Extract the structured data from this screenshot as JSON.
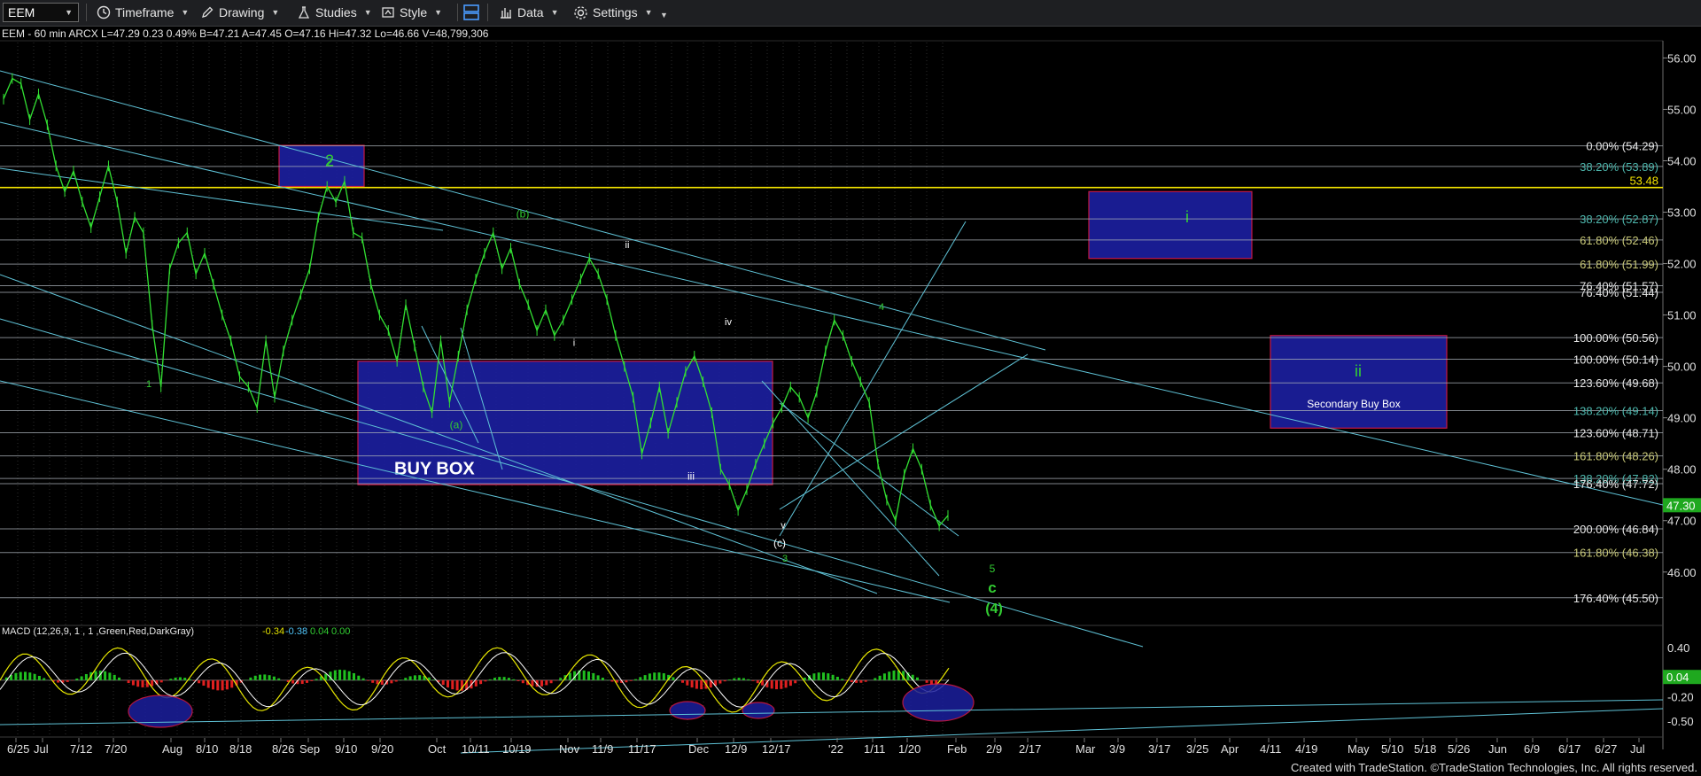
{
  "toolbar": {
    "symbol": "EEM",
    "timeframe": "Timeframe",
    "drawing": "Drawing",
    "studies": "Studies",
    "style": "Style",
    "data": "Data",
    "settings": "Settings"
  },
  "header": {
    "info": "EEM - 60 min  ARCX  L=47.29  0.23  0.49%  B=47.21  A=47.45  O=47.16  Hi=47.32  Lo=46.66  V=48,799,306"
  },
  "macd": {
    "label": "MACD (12,26,9, 1 , 1 ,Green,Red,DarkGray)",
    "v1": "-0.34",
    "v2": "-0.38",
    "v3": "0.04",
    "v4": "0.00"
  },
  "chart_data": {
    "type": "line",
    "price_axis": {
      "ticks": [
        "56.00",
        "55.00",
        "54.00",
        "53.00",
        "52.00",
        "51.00",
        "50.00",
        "49.00",
        "48.00",
        "47.00",
        "46.00"
      ],
      "range": [
        45.1,
        56.3
      ]
    },
    "macd_axis": {
      "ticks": [
        "0.40",
        "-0.20",
        "-0.50"
      ],
      "range": [
        -0.62,
        0.52
      ]
    },
    "x_labels": [
      "6/25",
      "Jul",
      "7/12",
      "7/20",
      "Aug",
      "8/10",
      "8/18",
      "8/26",
      "Sep",
      "9/10",
      "9/20",
      "Oct",
      "10/11",
      "10/19",
      "Nov",
      "11/9",
      "11/17",
      "Dec",
      "12/9",
      "12/17",
      "'22",
      "1/11",
      "1/20",
      "Feb",
      "2/9",
      "2/17",
      "Mar",
      "3/9",
      "3/17",
      "3/25",
      "Apr",
      "4/11",
      "4/19",
      "May",
      "5/10",
      "5/18",
      "5/26",
      "Jun",
      "6/9",
      "6/17",
      "6/27",
      "Jul"
    ],
    "last_price": "47.30",
    "last_macd": "0.04",
    "series": [
      {
        "values": [
          55.2,
          55.6,
          55.5,
          54.8,
          55.3,
          54.7,
          53.9,
          53.4,
          53.8,
          53.2,
          52.7,
          53.3,
          53.9,
          53.2,
          52.2,
          52.9,
          52.6,
          50.8,
          49.6,
          51.9,
          52.4,
          52.6,
          51.8,
          52.2,
          51.6,
          51.0,
          50.5,
          49.8,
          49.6,
          49.2,
          50.5,
          49.4,
          50.3,
          50.9,
          51.4,
          51.9,
          52.9,
          53.5,
          53.2,
          53.6,
          52.6,
          52.5,
          51.6,
          51.0,
          50.7,
          50.1,
          51.2,
          50.4,
          49.6,
          49.1,
          50.5,
          49.3,
          50.2,
          51.1,
          51.7,
          52.2,
          52.6,
          51.9,
          52.3,
          51.6,
          51.2,
          50.7,
          51.1,
          50.6,
          50.9,
          51.3,
          51.7,
          52.1,
          51.8,
          51.3,
          50.6,
          50.0,
          49.4,
          48.3,
          48.9,
          49.6,
          48.7,
          49.3,
          49.9,
          50.2,
          49.7,
          49.1,
          48.0,
          47.7,
          47.2,
          47.6,
          48.1,
          48.5,
          48.9,
          49.2,
          49.6,
          49.4,
          49.0,
          49.5,
          50.3,
          50.9,
          50.6,
          50.1,
          49.7,
          49.3,
          48.1,
          47.4,
          47.0,
          47.9,
          48.4,
          48.0,
          47.3,
          46.9,
          47.1
        ]
      }
    ],
    "fib_levels": [
      {
        "label": "0.00% (54.29)",
        "value": 54.29
      },
      {
        "label": "38.20% (53.89)",
        "value": 53.89
      },
      {
        "label": "38.20% (52.87)",
        "value": 52.87
      },
      {
        "label": "61.80% (52.46)",
        "value": 52.46
      },
      {
        "label": "61.80% (51.99)",
        "value": 51.99
      },
      {
        "label": "76.40% (51.57)",
        "value": 51.57
      },
      {
        "label": "76.40% (51.44)",
        "value": 51.44
      },
      {
        "label": "100.00% (50.56)",
        "value": 50.56
      },
      {
        "label": "100.00% (50.14)",
        "value": 50.14
      },
      {
        "label": "123.60% (49.68)",
        "value": 49.68
      },
      {
        "label": "138.20% (49.14)",
        "value": 49.14
      },
      {
        "label": "123.60% (48.71)",
        "value": 48.71
      },
      {
        "label": "161.80% (48.26)",
        "value": 48.26
      },
      {
        "label": "138.20% (47.82)",
        "value": 47.82
      },
      {
        "label": "176.40% (47.72)",
        "value": 47.72
      },
      {
        "label": "200.00% (46.84)",
        "value": 46.84
      },
      {
        "label": "161.80% (46.38)",
        "value": 46.38
      },
      {
        "label": "176.40% (45.50)",
        "value": 45.5
      }
    ],
    "resistance": {
      "label": "53.48",
      "value": 53.48
    },
    "boxes": [
      {
        "label": "2",
        "top": 54.3,
        "bottom": 53.5
      },
      {
        "label": "BUY BOX",
        "top": 50.1,
        "bottom": 47.7
      },
      {
        "label": "i",
        "top": 53.4,
        "bottom": 52.1
      },
      {
        "label": "ii",
        "top": 50.6,
        "bottom": 48.8
      },
      {
        "label": "Secondary Buy Box",
        "top": 50.6,
        "bottom": 48.8
      }
    ],
    "wave_labels": [
      "1",
      "2",
      "(a)",
      "(b)",
      "i",
      "ii",
      "iii",
      "iv",
      "v",
      "(c)",
      "3",
      "4",
      "5",
      "c",
      "(4)"
    ]
  },
  "footer": "Created with TradeStation. ©TradeStation Technologies, Inc. All rights reserved."
}
